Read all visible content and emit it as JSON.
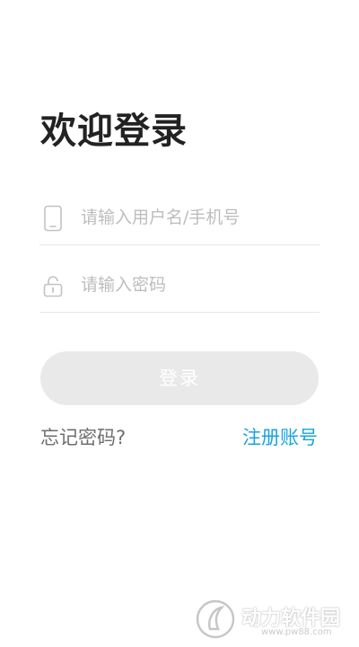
{
  "login": {
    "title": "欢迎登录",
    "username_placeholder": "请输入用户名/手机号",
    "password_placeholder": "请输入密码",
    "login_button": "登录",
    "forgot_password": "忘记密码?",
    "register": "注册账号",
    "accent_color": "#1aa3dd"
  },
  "icons": {
    "username": "phone-icon",
    "password": "lock-icon"
  },
  "watermark": {
    "text": "动力软件园",
    "url": "www.pw88.com"
  }
}
